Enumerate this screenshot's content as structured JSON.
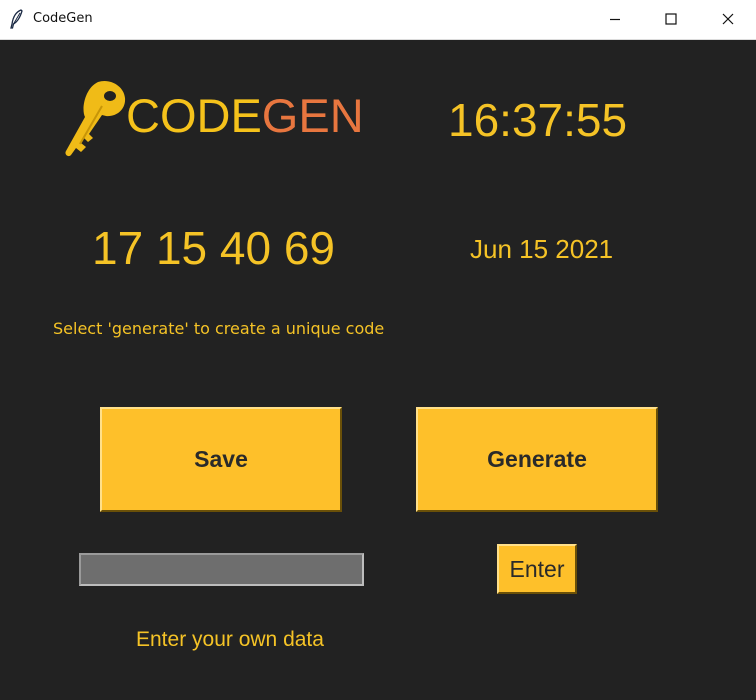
{
  "window": {
    "title": "CodeGen",
    "app_icon": "feather-icon",
    "controls": [
      "minimize-icon",
      "maximize-icon",
      "close-icon"
    ]
  },
  "logo": {
    "icon": "key-icon",
    "text_code": "CODE",
    "text_gen": "GEN"
  },
  "clock": "16:37:55",
  "code": "17 15 40 69",
  "date": "Jun 15 2021",
  "instruction": "Select 'generate' to create a unique code",
  "buttons": {
    "save": "Save",
    "generate": "Generate",
    "enter": "Enter"
  },
  "input": {
    "value": "",
    "placeholder": ""
  },
  "hint": "Enter your own data",
  "colors": {
    "background": "#222222",
    "accent_yellow": "#f5c326",
    "button_yellow": "#fec02a",
    "logo_orange": "#e8763f"
  }
}
